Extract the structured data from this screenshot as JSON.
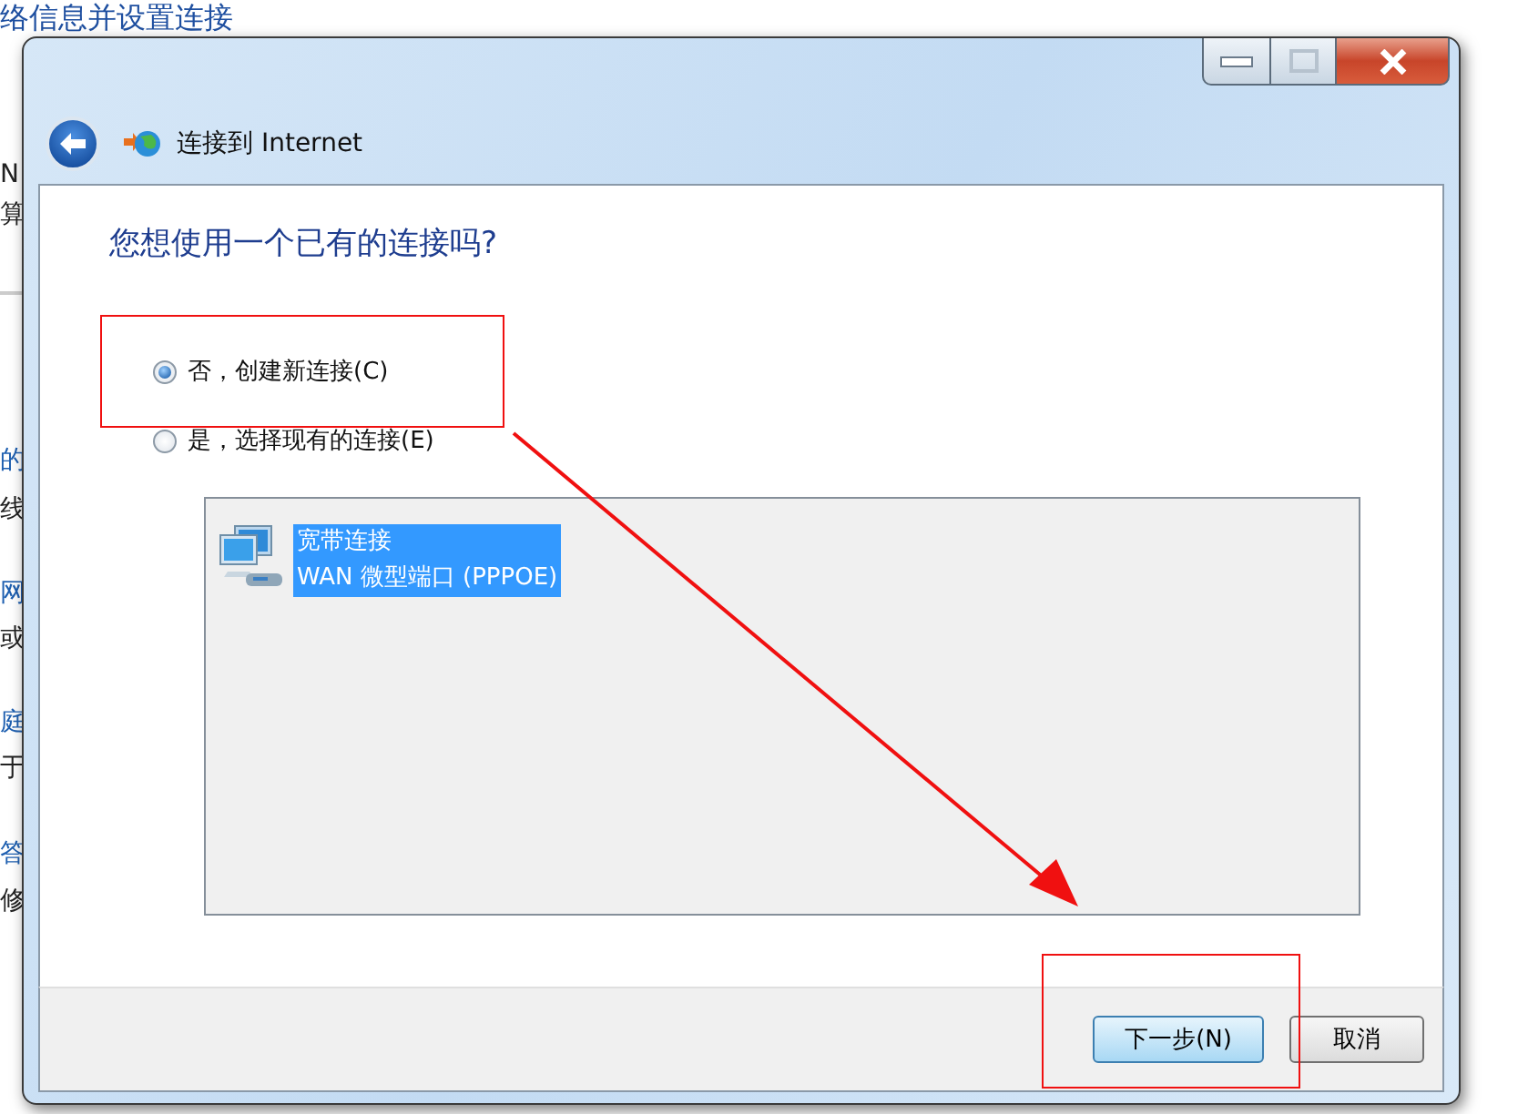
{
  "background_window": {
    "heading": "络信息并设置连接",
    "fragments": [
      {
        "text": "N",
        "kind": "text"
      },
      {
        "text": "算",
        "kind": "text"
      },
      {
        "text": "的",
        "kind": "link"
      },
      {
        "text": "线",
        "kind": "text"
      },
      {
        "text": "网",
        "kind": "link"
      },
      {
        "text": "或",
        "kind": "text"
      },
      {
        "text": "庭",
        "kind": "link"
      },
      {
        "text": "于",
        "kind": "text"
      },
      {
        "text": "答",
        "kind": "link"
      },
      {
        "text": "修",
        "kind": "text"
      }
    ]
  },
  "dialog": {
    "title": "连接到 Internet",
    "heading": "您想使用一个已有的连接吗?",
    "options": [
      {
        "label": "否，创建新连接(C)",
        "selected": true
      },
      {
        "label": "是，选择现有的连接(E)",
        "selected": false
      }
    ],
    "connections": [
      {
        "name": "宽带连接",
        "device": "WAN 微型端口 (PPPOE)",
        "selected": true
      }
    ],
    "buttons": [
      {
        "label": "下一步(N)",
        "default": true
      },
      {
        "label": "取消",
        "default": false
      }
    ]
  }
}
